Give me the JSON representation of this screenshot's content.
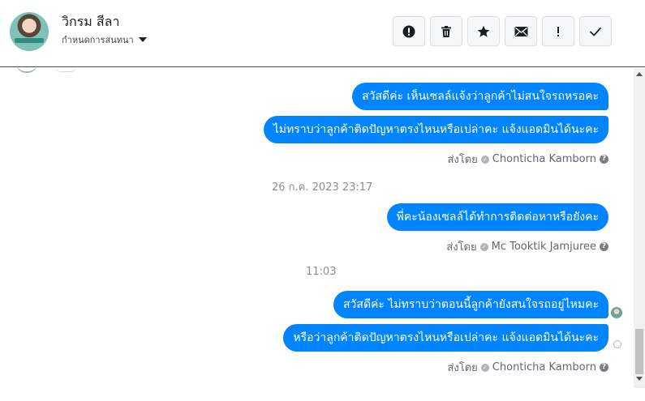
{
  "header": {
    "contact_name": "วิกรม สีลา",
    "subtitle": "กำหนดการสนทนา",
    "actions": [
      {
        "name": "mark-spam-button",
        "icon": "alert-circle-icon"
      },
      {
        "name": "delete-button",
        "icon": "trash-icon"
      },
      {
        "name": "star-button",
        "icon": "star-icon"
      },
      {
        "name": "mark-unread-button",
        "icon": "envelope-icon"
      },
      {
        "name": "follow-up-button",
        "icon": "exclamation-icon"
      },
      {
        "name": "mark-done-button",
        "icon": "checkmark-icon"
      }
    ]
  },
  "conversation": {
    "group1": {
      "messages": [
        "สวัสดีค่ะ เห็นเซลล์แจ้งว่าลูกค้าไม่สนใจรถหรอคะ",
        "ไม่ทราบว่าลูกค้าติดปัญหาตรงไหนหรือเปล่าคะ แจ้งแอดมินได้นะคะ"
      ],
      "sent_by_label": "ส่งโดย",
      "sender": "Chonticha Kamborn"
    },
    "timestamp1": "26 ก.ค. 2023 23:17",
    "group2": {
      "messages": [
        "พี่คะน้องเซลล์ได้ทำการติดต่อหาหรือยังคะ"
      ],
      "sent_by_label": "ส่งโดย",
      "sender": "Mc Tooktik Jamjuree"
    },
    "timestamp2": "11:03",
    "group3": {
      "messages": [
        "สวัสดีค่ะ ไม่ทราบว่าตอนนี้ลูกค้ายังสนใจรถอยู่ไหมคะ",
        "หรือว่าลูกค้าติดปัญหาตรงไหนหรือเปล่าคะ แจ้งแอดมินได้นะคะ"
      ],
      "sent_by_label": "ส่งโดย",
      "sender": "Chonticha Kamborn"
    }
  },
  "colors": {
    "bubble": "#0084ff",
    "bubble_text": "#ffffff",
    "meta_text": "#606770",
    "timestamp_text": "#8a8d91"
  }
}
